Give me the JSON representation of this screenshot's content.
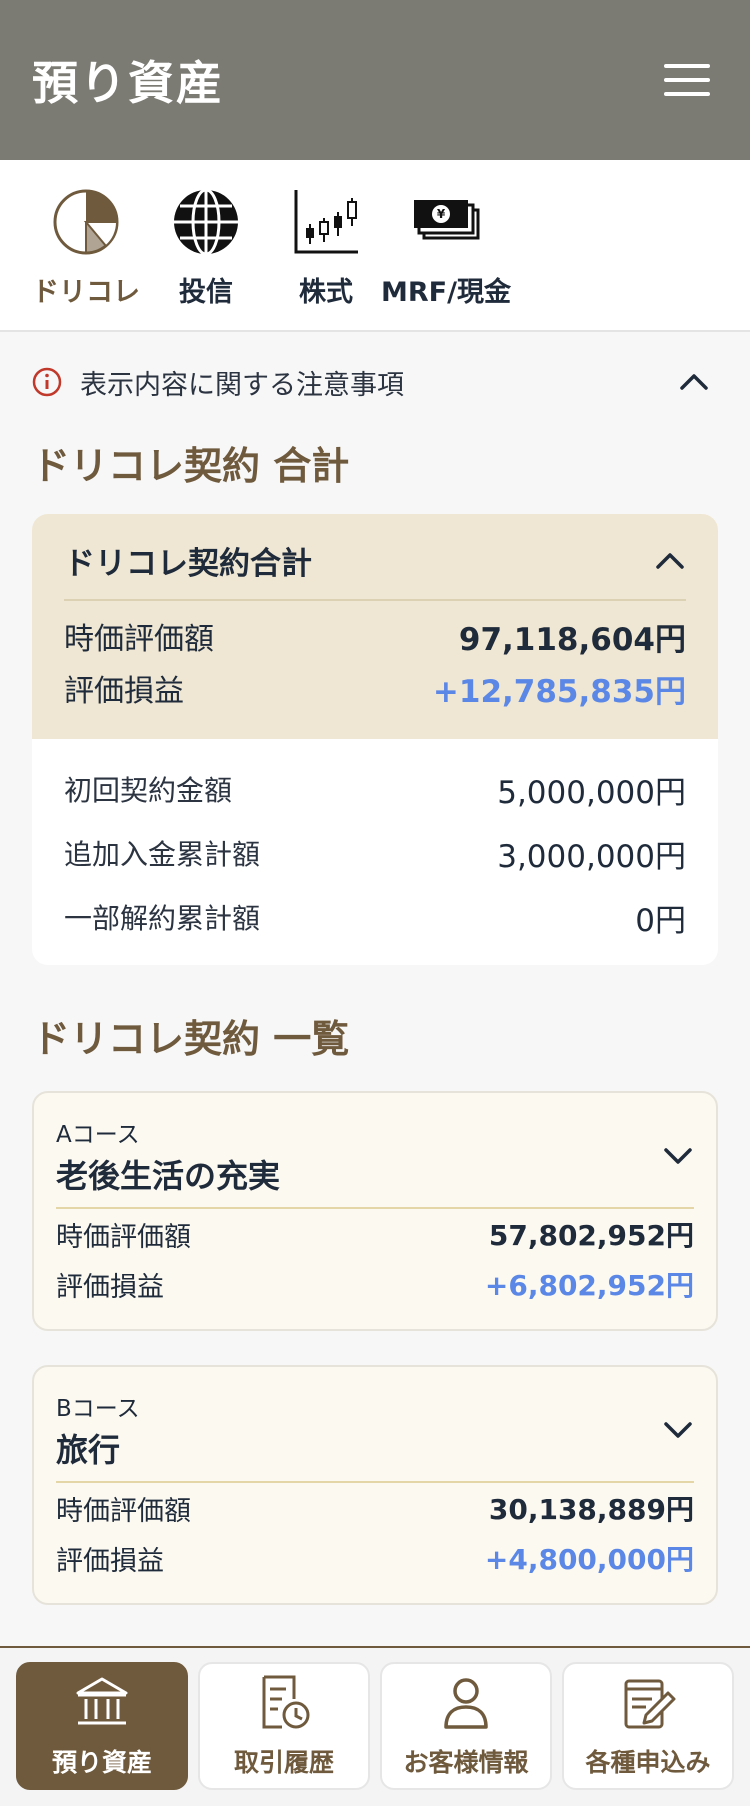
{
  "header": {
    "title": "預り資産"
  },
  "categories": [
    {
      "label": "ドリコレ",
      "icon": "pie-chart-icon"
    },
    {
      "label": "投信",
      "icon": "globe-icon"
    },
    {
      "label": "株式",
      "icon": "candlestick-icon"
    },
    {
      "label": "MRF/現金",
      "icon": "cash-icon"
    }
  ],
  "notice": {
    "text": "表示内容に関する注意事項"
  },
  "total_section": {
    "title": "ドリコレ契約 合計"
  },
  "total_card": {
    "title": "ドリコレ契約合計",
    "market_value_label": "時価評価額",
    "market_value": "97,118,604円",
    "pnl_label": "評価損益",
    "pnl": "+12,785,835円",
    "details": [
      {
        "label": "初回契約金額",
        "value": "5,000,000円"
      },
      {
        "label": "追加入金累計額",
        "value": "3,000,000円"
      },
      {
        "label": "一部解約累計額",
        "value": "0円"
      }
    ]
  },
  "list_section": {
    "title": "ドリコレ契約 一覧"
  },
  "courses": [
    {
      "course": "Aコース",
      "name": "老後生活の充実",
      "market_value_label": "時価評価額",
      "market_value": "57,802,952円",
      "pnl_label": "評価損益",
      "pnl": "+6,802,952円"
    },
    {
      "course": "Bコース",
      "name": "旅行",
      "market_value_label": "時価評価額",
      "market_value": "30,138,889円",
      "pnl_label": "評価損益",
      "pnl": "+4,800,000円"
    }
  ],
  "bottom_nav": [
    {
      "label": "預り資産",
      "icon": "bank-icon"
    },
    {
      "label": "取引履歴",
      "icon": "history-icon"
    },
    {
      "label": "お客様情報",
      "icon": "person-icon"
    },
    {
      "label": "各種申込み",
      "icon": "form-edit-icon"
    }
  ],
  "colors": {
    "header_bg": "#7b7a73",
    "accent_brown": "#6f5a3d",
    "card_beige": "#efe7d3",
    "profit_blue": "#5b87e6"
  }
}
